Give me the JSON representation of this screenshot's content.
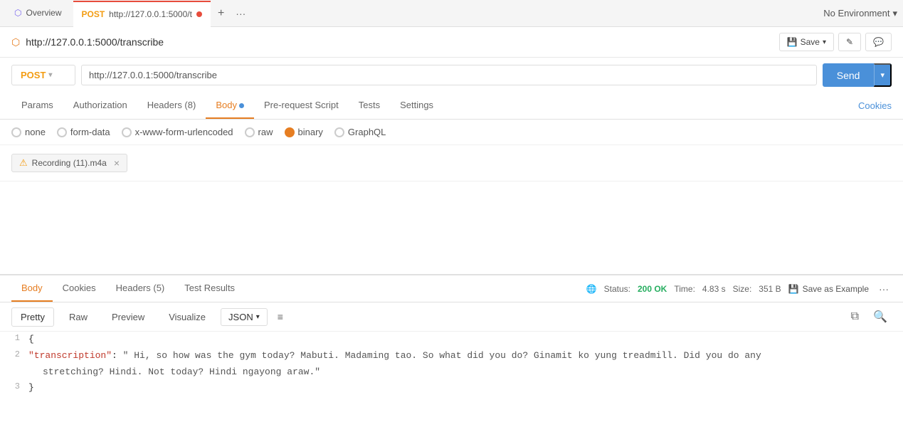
{
  "tabBar": {
    "overviewLabel": "Overview",
    "activeTab": {
      "method": "POST",
      "url": "http://127.0.0.1:5000/t",
      "hasDot": true
    },
    "addLabel": "+",
    "moreLabel": "···",
    "environment": "No Environment"
  },
  "urlBar": {
    "title": "http://127.0.0.1:5000/transcribe",
    "saveLabel": "Save",
    "collectionIcon": "⬡"
  },
  "request": {
    "method": "POST",
    "url": "http://127.0.0.1:5000/transcribe",
    "sendLabel": "Send"
  },
  "tabs": {
    "items": [
      "Params",
      "Authorization",
      "Headers (8)",
      "Body",
      "Pre-request Script",
      "Tests",
      "Settings"
    ],
    "activeIndex": 3,
    "cookiesLabel": "Cookies"
  },
  "bodyOptions": {
    "options": [
      "none",
      "form-data",
      "x-www-form-urlencoded",
      "raw",
      "binary",
      "GraphQL"
    ],
    "selectedIndex": 4
  },
  "fileArea": {
    "filename": "Recording (11).m4a",
    "warningIcon": "⚠",
    "closeIcon": "×"
  },
  "responseTabs": {
    "items": [
      "Body",
      "Cookies",
      "Headers (5)",
      "Test Results"
    ],
    "activeIndex": 0
  },
  "responseMeta": {
    "globeIcon": "🌐",
    "statusLabel": "Status:",
    "statusValue": "200 OK",
    "timeLabel": "Time:",
    "timeValue": "4.83 s",
    "sizeLabel": "Size:",
    "sizeValue": "351 B",
    "saveIcon": "💾",
    "saveExampleLabel": "Save as Example",
    "moreIcon": "···"
  },
  "viewTabs": {
    "items": [
      "Pretty",
      "Raw",
      "Preview",
      "Visualize"
    ],
    "activeIndex": 0,
    "format": "JSON",
    "wrapIcon": "≡",
    "copyIcon": "⧉",
    "searchIcon": "🔍"
  },
  "codeLines": {
    "line1": "{",
    "line2_key": "\"transcription\"",
    "line2_colon": ": ",
    "line2_val1": "\" Hi, so how was the gym today? Mabuti. Madaming tao. So what did you do? Ginamit ko yung treadmill. Did you do any",
    "line2_val2": "stretching? Hindi. Not today? Hindi ngayong araw.\"",
    "line3": "}"
  }
}
